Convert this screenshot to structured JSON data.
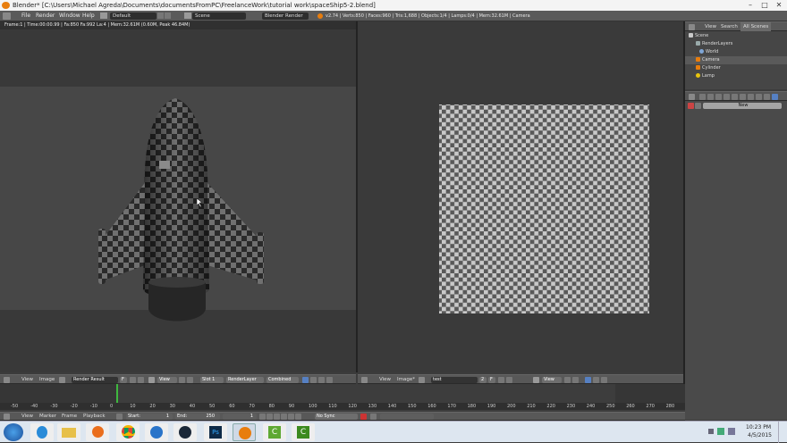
{
  "window": {
    "title": "Blender* [C:\\Users\\Michael Agreda\\Documents\\documentsFromPC\\FreelanceWork\\tutorial work\\spaceShip5-2.blend]",
    "minimize": "–",
    "maximize": "□",
    "close": "✕"
  },
  "menu": {
    "items": [
      "File",
      "Render",
      "Window",
      "Help"
    ],
    "layout": "Default",
    "scene": "Scene",
    "engine": "Blender Render",
    "stats": "v2.74 | Verts:850 | Faces:960 | Tris:1,688 | Objects:1/4 | Lamps:0/4 | Mem:32.61M | Camera"
  },
  "left_view": {
    "info": "Frame:1 | Time:00:00.99 | Fa:850 Fa:992 La:4 | Mem:32.61M (0.60M, Peak 46.84M)",
    "header": {
      "view": "View",
      "image": "Image",
      "render_result": "Render Result",
      "f": "F",
      "view2": "View",
      "slot": "Slot 1",
      "layer": "RenderLayer",
      "pass": "Combined"
    }
  },
  "right_view": {
    "header": {
      "view": "View",
      "image": "Image*",
      "image_name": "test",
      "users": "2",
      "f": "F",
      "view2": "View"
    }
  },
  "outliner": {
    "tabs": [
      "View",
      "Search",
      "All Scenes"
    ],
    "items": [
      "Scene",
      "RenderLayers",
      "World",
      "Camera",
      "Cylinder",
      "Lamp"
    ]
  },
  "properties": {
    "new_button": "New"
  },
  "timeline": {
    "menu": [
      "View",
      "Marker",
      "Frame",
      "Playback"
    ],
    "start": "Start:",
    "start_val": "1",
    "end": "End:",
    "end_val": "250",
    "current": "1",
    "sync": "No Sync",
    "ruler": [
      "-50",
      "-40",
      "-30",
      "-20",
      "-10",
      "0",
      "10",
      "20",
      "30",
      "40",
      "50",
      "60",
      "70",
      "80",
      "90",
      "100",
      "110",
      "120",
      "130",
      "140",
      "150",
      "160",
      "170",
      "180",
      "190",
      "200",
      "210",
      "220",
      "230",
      "240",
      "250",
      "260",
      "270",
      "280"
    ]
  },
  "taskbar": {
    "time": "10:23 PM",
    "date": "4/5/2015"
  },
  "colors": {
    "accent": "#e87d0d",
    "selection": "#5680c2",
    "timeline_cursor": "#3fb83f"
  }
}
